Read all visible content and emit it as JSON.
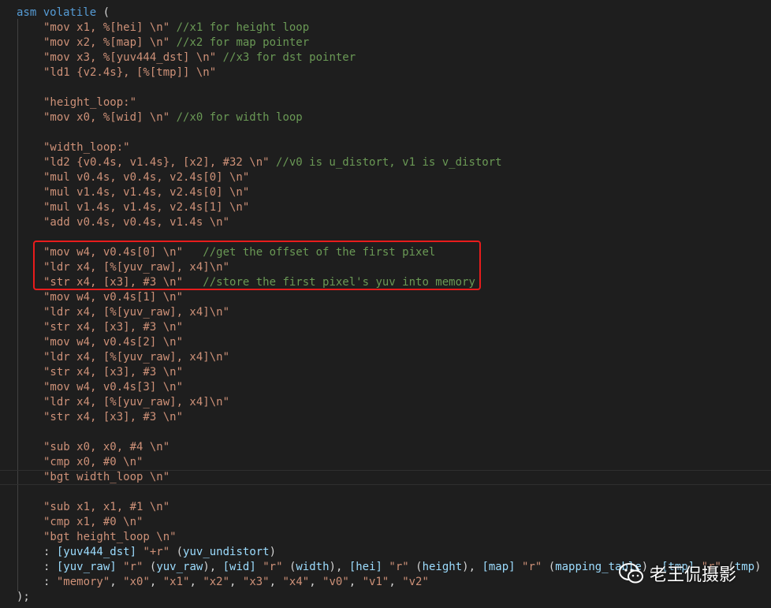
{
  "code": {
    "lines": [
      [
        {
          "t": "asm volatile ",
          "c": "kw"
        },
        {
          "t": "(",
          "c": "punc"
        }
      ],
      [
        {
          "t": "\"mov x1, %[hei] \\n\"",
          "c": "str"
        },
        {
          "t": " //x1 for height loop",
          "c": "cmt"
        }
      ],
      [
        {
          "t": "\"mov x2, %[map] \\n\"",
          "c": "str"
        },
        {
          "t": " //x2 for map pointer",
          "c": "cmt"
        }
      ],
      [
        {
          "t": "\"mov x3, %[yuv444_dst] \\n\"",
          "c": "str"
        },
        {
          "t": " //x3 for dst pointer",
          "c": "cmt"
        }
      ],
      [
        {
          "t": "\"ld1 {v2.4s}, [%[tmp]] \\n\"",
          "c": "str"
        }
      ],
      [],
      [
        {
          "t": "\"height_loop:\"",
          "c": "str"
        }
      ],
      [
        {
          "t": "\"mov x0, %[wid] \\n\"",
          "c": "str"
        },
        {
          "t": " //x0 for width loop",
          "c": "cmt"
        }
      ],
      [],
      [
        {
          "t": "\"width_loop:\"",
          "c": "str"
        }
      ],
      [
        {
          "t": "\"ld2 {v0.4s, v1.4s}, [x2], #32 \\n\"",
          "c": "str"
        },
        {
          "t": " //v0 is u_distort, v1 is v_distort",
          "c": "cmt"
        }
      ],
      [
        {
          "t": "\"mul v0.4s, v0.4s, v2.4s[0] \\n\"",
          "c": "str"
        }
      ],
      [
        {
          "t": "\"mul v1.4s, v1.4s, v2.4s[0] \\n\"",
          "c": "str"
        }
      ],
      [
        {
          "t": "\"mul v1.4s, v1.4s, v2.4s[1] \\n\"",
          "c": "str"
        }
      ],
      [
        {
          "t": "\"add v0.4s, v0.4s, v1.4s \\n\"",
          "c": "str"
        }
      ],
      [],
      [
        {
          "t": "\"mov w4, v0.4s[0] \\n\"",
          "c": "str"
        },
        {
          "t": "   //get the offset of the first pixel",
          "c": "cmt"
        }
      ],
      [
        {
          "t": "\"ldr x4, [%[yuv_raw], x4]\\n\"",
          "c": "str"
        }
      ],
      [
        {
          "t": "\"str x4, [x3], #3 \\n\"",
          "c": "str"
        },
        {
          "t": "   //store the first pixel's yuv into memory",
          "c": "cmt"
        }
      ],
      [
        {
          "t": "\"mov w4, v0.4s[1] \\n\"",
          "c": "str"
        }
      ],
      [
        {
          "t": "\"ldr x4, [%[yuv_raw], x4]\\n\"",
          "c": "str"
        }
      ],
      [
        {
          "t": "\"str x4, [x3], #3 \\n\"",
          "c": "str"
        }
      ],
      [
        {
          "t": "\"mov w4, v0.4s[2] \\n\"",
          "c": "str"
        }
      ],
      [
        {
          "t": "\"ldr x4, [%[yuv_raw], x4]\\n\"",
          "c": "str"
        }
      ],
      [
        {
          "t": "\"str x4, [x3], #3 \\n\"",
          "c": "str"
        }
      ],
      [
        {
          "t": "\"mov w4, v0.4s[3] \\n\"",
          "c": "str"
        }
      ],
      [
        {
          "t": "\"ldr x4, [%[yuv_raw], x4]\\n\"",
          "c": "str"
        }
      ],
      [
        {
          "t": "\"str x4, [x3], #3 \\n\"",
          "c": "str"
        }
      ],
      [],
      [
        {
          "t": "\"sub x0, x0, #4 \\n\"",
          "c": "str"
        }
      ],
      [
        {
          "t": "\"cmp x0, #0 \\n\"",
          "c": "str"
        }
      ],
      [
        {
          "t": "\"bgt width_loop \\n\"",
          "c": "str"
        }
      ],
      [],
      [
        {
          "t": "\"sub x1, x1, #1 \\n\"",
          "c": "str"
        }
      ],
      [
        {
          "t": "\"cmp x1, #0 \\n\"",
          "c": "str"
        }
      ],
      [
        {
          "t": "\"bgt height_loop \\n\"",
          "c": "str"
        }
      ],
      [
        {
          "t": ": ",
          "c": "punc"
        },
        {
          "t": "[yuv444_dst]",
          "c": "var"
        },
        {
          "t": " ",
          "c": "punc"
        },
        {
          "t": "\"+r\"",
          "c": "str"
        },
        {
          "t": " (",
          "c": "punc"
        },
        {
          "t": "yuv_undistort",
          "c": "var"
        },
        {
          "t": ")",
          "c": "punc"
        }
      ],
      [
        {
          "t": ": ",
          "c": "punc"
        },
        {
          "t": "[yuv_raw]",
          "c": "var"
        },
        {
          "t": " ",
          "c": "punc"
        },
        {
          "t": "\"r\"",
          "c": "str"
        },
        {
          "t": " (",
          "c": "punc"
        },
        {
          "t": "yuv_raw",
          "c": "var"
        },
        {
          "t": "), ",
          "c": "punc"
        },
        {
          "t": "[wid]",
          "c": "var"
        },
        {
          "t": " ",
          "c": "punc"
        },
        {
          "t": "\"r\"",
          "c": "str"
        },
        {
          "t": " (",
          "c": "punc"
        },
        {
          "t": "width",
          "c": "var"
        },
        {
          "t": "), ",
          "c": "punc"
        },
        {
          "t": "[hei]",
          "c": "var"
        },
        {
          "t": " ",
          "c": "punc"
        },
        {
          "t": "\"r\"",
          "c": "str"
        },
        {
          "t": " (",
          "c": "punc"
        },
        {
          "t": "height",
          "c": "var"
        },
        {
          "t": "), ",
          "c": "punc"
        },
        {
          "t": "[map]",
          "c": "var"
        },
        {
          "t": " ",
          "c": "punc"
        },
        {
          "t": "\"r\"",
          "c": "str"
        },
        {
          "t": " (",
          "c": "punc"
        },
        {
          "t": "mapping_table",
          "c": "var"
        },
        {
          "t": "), ",
          "c": "punc"
        },
        {
          "t": "[tmp]",
          "c": "var"
        },
        {
          "t": " ",
          "c": "punc"
        },
        {
          "t": "\"r\"",
          "c": "str"
        },
        {
          "t": " (",
          "c": "punc"
        },
        {
          "t": "tmp",
          "c": "var"
        },
        {
          "t": ")",
          "c": "punc"
        }
      ],
      [
        {
          "t": ": ",
          "c": "punc"
        },
        {
          "t": "\"memory\"",
          "c": "str"
        },
        {
          "t": ", ",
          "c": "punc"
        },
        {
          "t": "\"x0\"",
          "c": "str"
        },
        {
          "t": ", ",
          "c": "punc"
        },
        {
          "t": "\"x1\"",
          "c": "str"
        },
        {
          "t": ", ",
          "c": "punc"
        },
        {
          "t": "\"x2\"",
          "c": "str"
        },
        {
          "t": ", ",
          "c": "punc"
        },
        {
          "t": "\"x3\"",
          "c": "str"
        },
        {
          "t": ", ",
          "c": "punc"
        },
        {
          "t": "\"x4\"",
          "c": "str"
        },
        {
          "t": ", ",
          "c": "punc"
        },
        {
          "t": "\"v0\"",
          "c": "str"
        },
        {
          "t": ", ",
          "c": "punc"
        },
        {
          "t": "\"v1\"",
          "c": "str"
        },
        {
          "t": ", ",
          "c": "punc"
        },
        {
          "t": "\"v2\"",
          "c": "str"
        }
      ],
      [
        {
          "t": ");",
          "c": "punc"
        }
      ]
    ]
  },
  "watermark": {
    "text": "老王侃摄影"
  },
  "colors": {
    "background": "#1e1e1e",
    "string": "#ce9178",
    "comment": "#6a9955",
    "keyword": "#569cd6",
    "variable": "#9cdcfe",
    "highlight_border": "#e81c1c"
  }
}
